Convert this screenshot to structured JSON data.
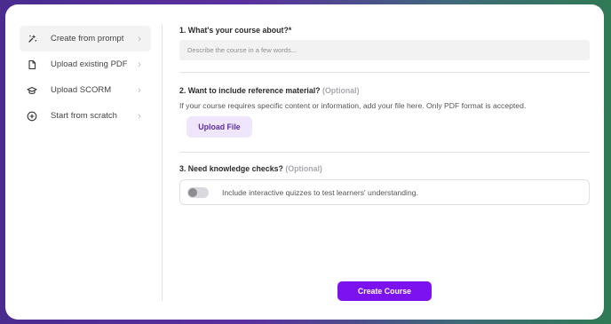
{
  "sidebar": {
    "items": [
      {
        "label": "Create from prompt",
        "icon": "sparkles-icon",
        "active": true
      },
      {
        "label": "Upload existing PDF",
        "icon": "document-icon",
        "active": false
      },
      {
        "label": "Upload SCORM",
        "icon": "graduation-cap-icon",
        "active": false
      },
      {
        "label": "Start from scratch",
        "icon": "plus-circle-icon",
        "active": false
      }
    ],
    "chevron": "›"
  },
  "main": {
    "q1": {
      "title": "1. What's your course about?*",
      "placeholder": "Describe the course in a few words..."
    },
    "q2": {
      "title": "2. Want to include reference material?",
      "optional": "(Optional)",
      "description": "If your course requires specific content or information, add your file here. Only PDF format is accepted.",
      "upload_label": "Upload File"
    },
    "q3": {
      "title": "3. Need knowledge checks?",
      "optional": "(Optional)",
      "toggle_label": "Include interactive quizzes to test learners' understanding.",
      "toggle_on": false
    },
    "submit_label": "Create Course"
  },
  "colors": {
    "accent": "#7c12f0",
    "upload_bg": "#efe6fb",
    "upload_text": "#5a2ea6",
    "sidebar_active_bg": "#f3f3f4"
  }
}
